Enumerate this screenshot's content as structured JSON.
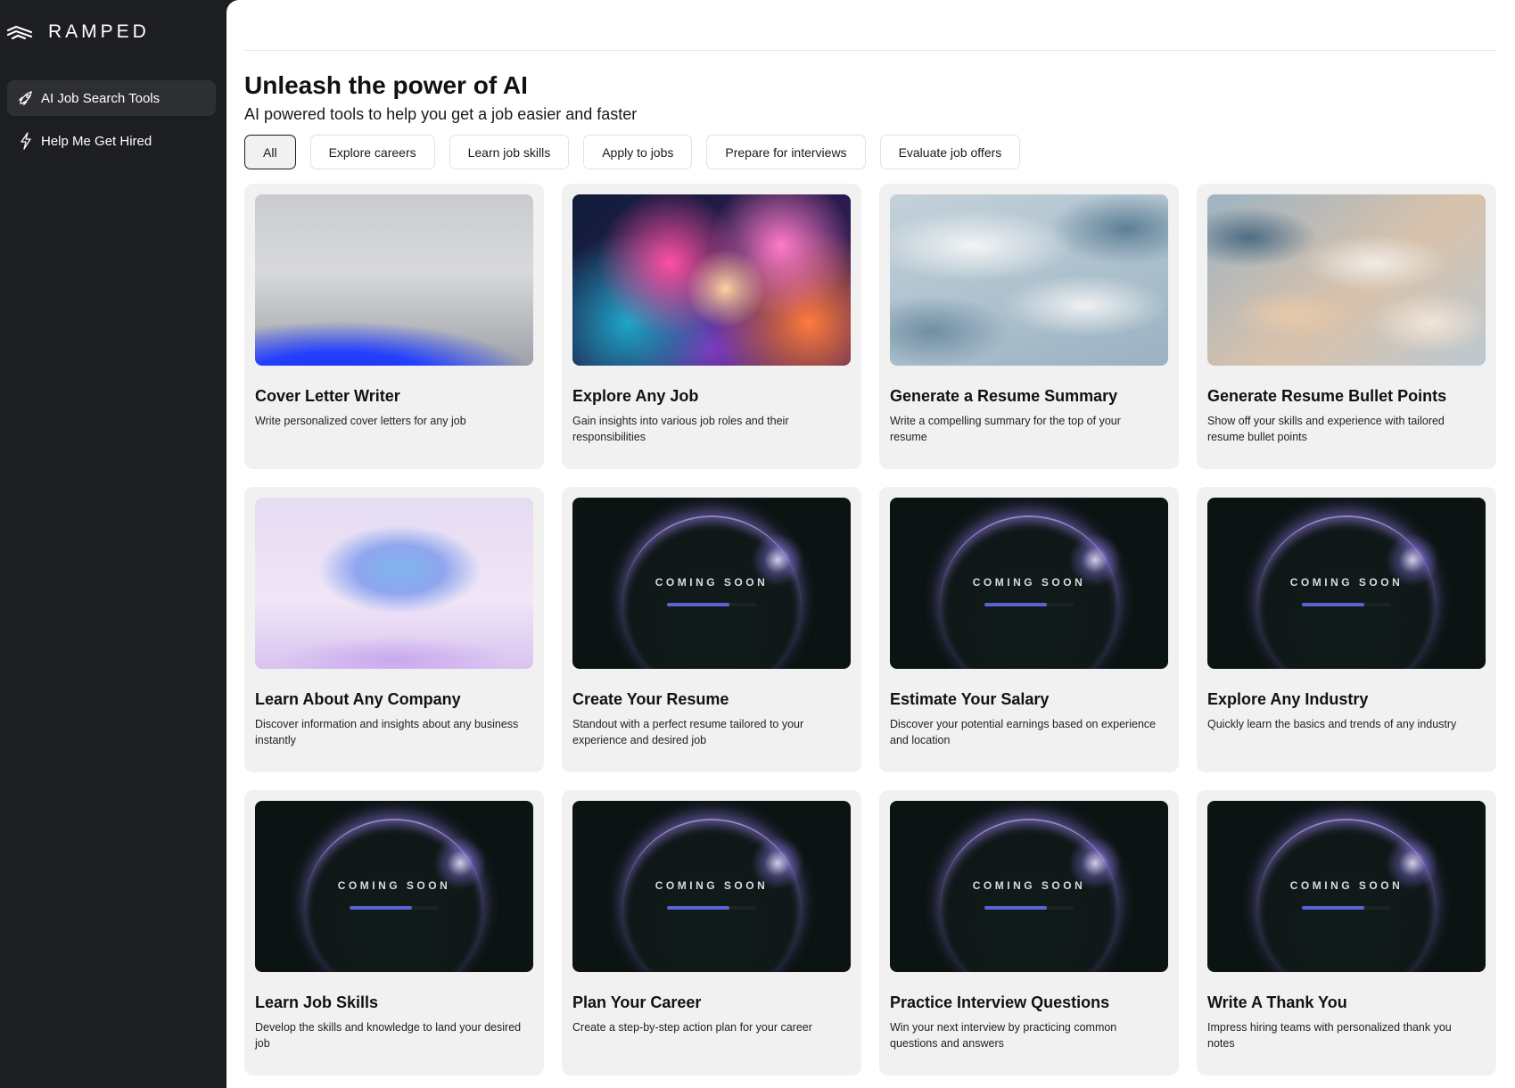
{
  "brand": {
    "name": "RAMPED"
  },
  "sidebar": {
    "items": [
      {
        "label": "AI Job Search Tools",
        "icon": "rocket-icon",
        "active": true
      },
      {
        "label": "Help Me Get Hired",
        "icon": "lightning-icon",
        "active": false
      }
    ]
  },
  "header": {
    "title": "Unleash the power of AI",
    "subtitle": "AI powered tools to help you get a job easier and faster"
  },
  "filters": [
    {
      "label": "All",
      "active": true
    },
    {
      "label": "Explore careers",
      "active": false
    },
    {
      "label": "Learn job skills",
      "active": false
    },
    {
      "label": "Apply to jobs",
      "active": false
    },
    {
      "label": "Prepare for interviews",
      "active": false
    },
    {
      "label": "Evaluate job offers",
      "active": false
    }
  ],
  "tools": [
    {
      "title": "Cover Letter Writer",
      "description": "Write personalized cover letters for any job",
      "thumb": "wave"
    },
    {
      "title": "Explore Any Job",
      "description": "Gain insights into various job roles and their responsibilities",
      "thumb": "splash"
    },
    {
      "title": "Generate a Resume Summary",
      "description": "Write a compelling summary for the top of your resume",
      "thumb": "silk"
    },
    {
      "title": "Generate Resume Bullet Points",
      "description": "Show off your skills and experience with tailored resume bullet points",
      "thumb": "sand"
    },
    {
      "title": "Learn About Any Company",
      "description": "Discover information and insights about any business instantly",
      "thumb": "ribbon"
    },
    {
      "title": "Create Your Resume",
      "description": "Standout with a perfect resume tailored to your experience and desired job",
      "thumb": "soon"
    },
    {
      "title": "Estimate Your Salary",
      "description": "Discover your potential earnings based on experience and location",
      "thumb": "soon"
    },
    {
      "title": "Explore Any Industry",
      "description": "Quickly learn the basics and trends of any industry",
      "thumb": "soon"
    },
    {
      "title": "Learn Job Skills",
      "description": "Develop the skills and knowledge to land your desired job",
      "thumb": "soon"
    },
    {
      "title": "Plan Your Career",
      "description": "Create a step-by-step action plan for your career",
      "thumb": "soon"
    },
    {
      "title": "Practice Interview Questions",
      "description": "Win your next interview by practicing common questions and answers",
      "thumb": "soon"
    },
    {
      "title": "Write A Thank You",
      "description": "Impress hiring teams with personalized thank you notes",
      "thumb": "soon"
    }
  ],
  "coming_soon": {
    "label": "COMING SOON",
    "progress": 0.7
  }
}
